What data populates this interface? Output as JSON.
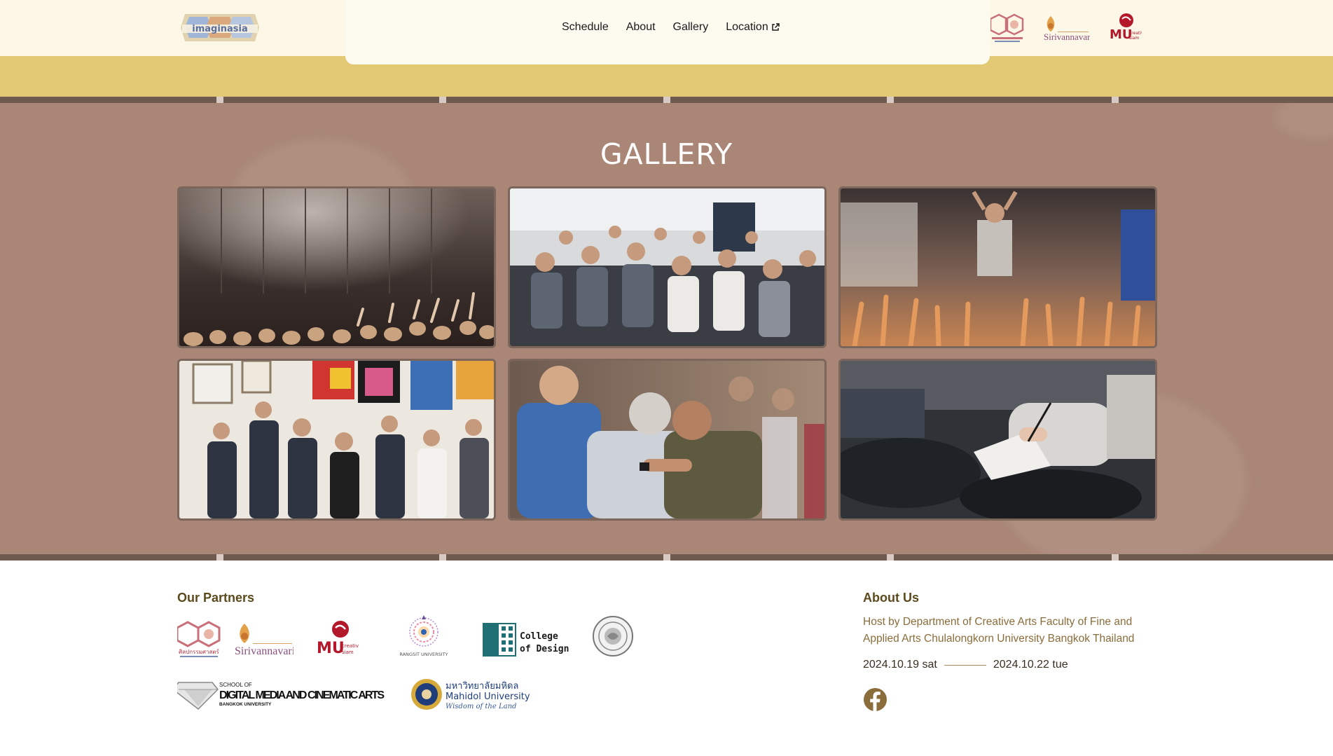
{
  "header": {
    "brand_logo_text": "imaginasia",
    "nav": [
      {
        "label": "Schedule"
      },
      {
        "label": "About"
      },
      {
        "label": "Gallery"
      },
      {
        "label": "Location",
        "icon": "external-link-icon"
      }
    ],
    "partner_logos": [
      "fine-arts-chula-logo",
      "sirivannavari-logo",
      "mu-creative-siam-logo"
    ]
  },
  "gallery": {
    "title": "GALLERY",
    "photos": [
      {
        "name": "concert-crowd-photo"
      },
      {
        "name": "seated-audience-photo"
      },
      {
        "name": "raised-hands-photo"
      },
      {
        "name": "art-workshop-photo"
      },
      {
        "name": "hugging-men-photo"
      },
      {
        "name": "note-taking-photo"
      }
    ]
  },
  "footer": {
    "partners_title": "Our Partners",
    "partners": [
      {
        "name": "fine-arts-chula-logo",
        "caption": "ศิลปกรรมศาสตร์"
      },
      {
        "name": "sirivannavari-logo",
        "caption": "Sirivannavari"
      },
      {
        "name": "mu-creative-siam-logo",
        "caption": "MU"
      },
      {
        "name": "rangsit-university-logo",
        "caption": "RANGSIT UNIVERSITY"
      },
      {
        "name": "college-of-design-logo",
        "caption": "College of Design"
      },
      {
        "name": "seal-logo",
        "caption": ""
      },
      {
        "name": "bangkok-university-logo",
        "caption_small": "SCHOOL OF",
        "caption": "DIGITAL MEDIA AND CINEMATIC ARTS",
        "caption_sub": "BANGKOK UNIVERSITY"
      },
      {
        "name": "mahidol-university-logo",
        "caption_thai": "มหาวิทยาลัยมหิดล",
        "caption": "Mahidol University",
        "caption_sub": "Wisdom of the Land"
      }
    ],
    "about_title": "About Us",
    "about_text": "Host by Department of Creative Arts Faculty of Fine and Applied Arts Chulalongkorn University Bangkok Thailand",
    "date_start": "2024.10.19 sat",
    "date_end": "2024.10.22 tue"
  }
}
